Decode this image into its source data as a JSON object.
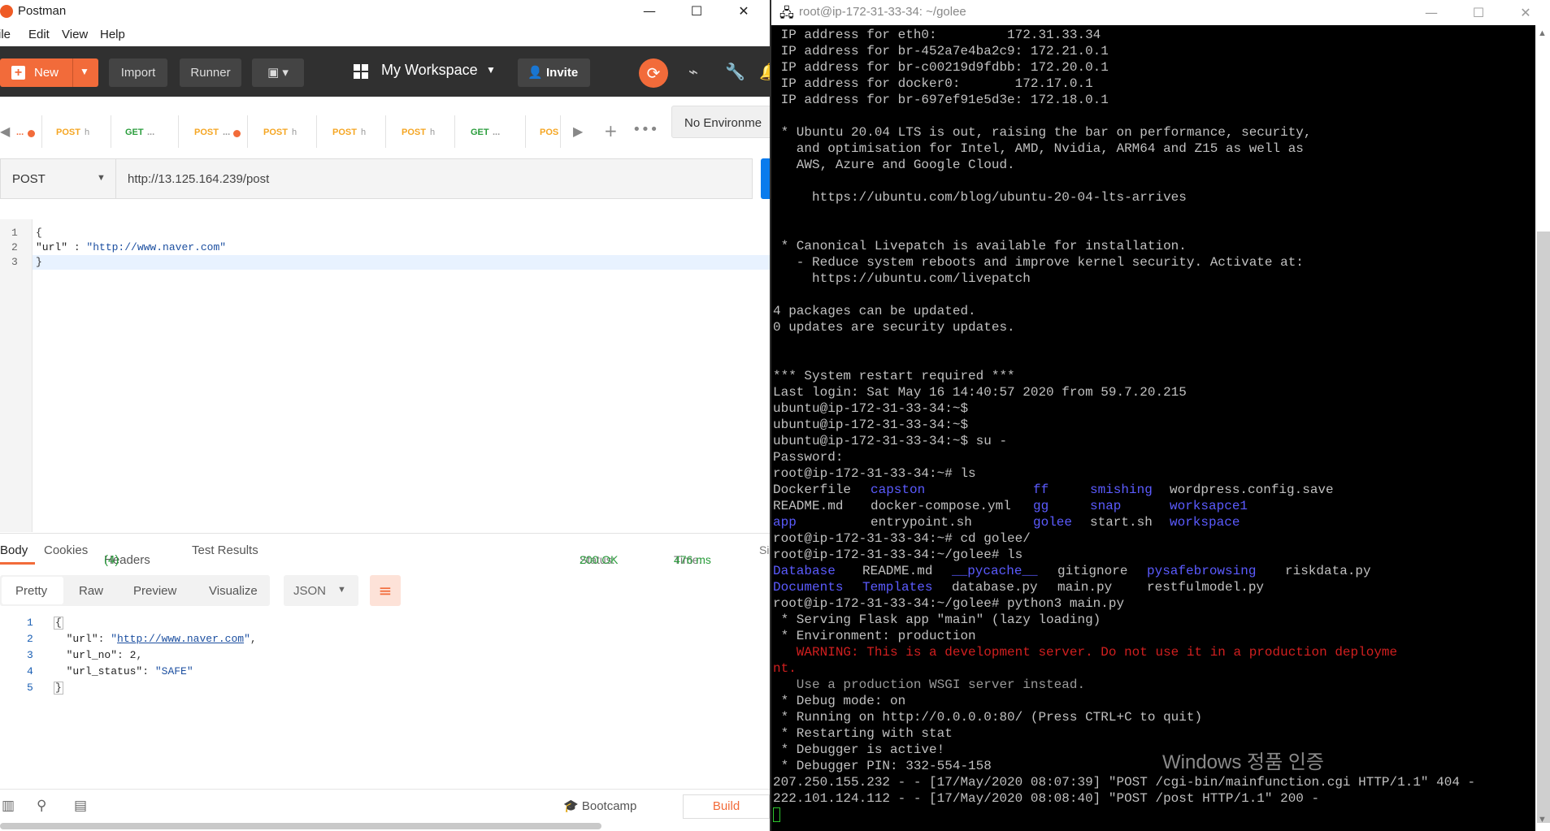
{
  "postman": {
    "title": "Postman",
    "menu": [
      "File",
      "Edit",
      "View",
      "Help"
    ],
    "menu_visible": [
      "ile",
      "Edit",
      "View",
      "Help"
    ],
    "toolbar": {
      "new_label": "New",
      "import_label": "Import",
      "runner_label": "Runner",
      "workspace_label": "My Workspace",
      "invite_label": "Invite"
    },
    "tabs": [
      {
        "method": "...",
        "dirty": true
      },
      {
        "method": "POST",
        "name": "h"
      },
      {
        "method": "GET",
        "name": "..."
      },
      {
        "method": "POST",
        "name": "...",
        "dirty": true
      },
      {
        "method": "POST",
        "name": "h"
      },
      {
        "method": "POST",
        "name": "h"
      },
      {
        "method": "POST",
        "name": "h"
      },
      {
        "method": "GET",
        "name": "..."
      },
      {
        "method": "POS",
        "name": ""
      }
    ],
    "environment": "No Environme",
    "request": {
      "method": "POST",
      "url": "http://13.125.164.239/post",
      "body_lines": [
        "1",
        "2",
        "3"
      ]
    },
    "response_tabs": {
      "body": "Body",
      "cookies": "Cookies",
      "headers": "Headers",
      "headers_count": "(4)",
      "test_results": "Test Results",
      "status_label": "Status:",
      "status_value": "200 OK",
      "time_label": "Time:",
      "time_value": "476 ms",
      "size_label": "Si"
    },
    "view_modes": [
      "Pretty",
      "Raw",
      "Preview",
      "Visualize"
    ],
    "format": "JSON",
    "response_lines": [
      "1",
      "2",
      "3",
      "4",
      "5"
    ],
    "footer": {
      "bootcamp": "Bootcamp",
      "build": "Build"
    },
    "colors": {
      "accent": "#f26b3a",
      "toolbar": "#303030",
      "status_green": "#2a9d3c"
    }
  },
  "terminal": {
    "title": "root@ip-172-31-33-34: ~/golee",
    "lines": [
      {
        "t": " IP address for eth0:         172.31.33.34"
      },
      {
        "t": " IP address for br-452a7e4ba2c9: 172.21.0.1"
      },
      {
        "t": " IP address for br-c00219d9fdbb: 172.20.0.1"
      },
      {
        "t": " IP address for docker0:       172.17.0.1"
      },
      {
        "t": " IP address for br-697ef91e5d3e: 172.18.0.1"
      },
      {
        "t": ""
      },
      {
        "t": " * Ubuntu 20.04 LTS is out, raising the bar on performance, security,"
      },
      {
        "t": "   and optimisation for Intel, AMD, Nvidia, ARM64 and Z15 as well as"
      },
      {
        "t": "   AWS, Azure and Google Cloud."
      },
      {
        "t": ""
      },
      {
        "t": "     https://ubuntu.com/blog/ubuntu-20-04-lts-arrives"
      },
      {
        "t": ""
      },
      {
        "t": ""
      },
      {
        "t": " * Canonical Livepatch is available for installation."
      },
      {
        "t": "   - Reduce system reboots and improve kernel security. Activate at:"
      },
      {
        "t": "     https://ubuntu.com/livepatch"
      },
      {
        "t": ""
      },
      {
        "t": "4 packages can be updated."
      },
      {
        "t": "0 updates are security updates."
      },
      {
        "t": ""
      },
      {
        "t": ""
      },
      {
        "t": "*** System restart required ***"
      },
      {
        "t": "Last login: Sat May 16 14:40:57 2020 from 59.7.20.215"
      },
      {
        "t": "ubuntu@ip-172-31-33-34:~$"
      },
      {
        "t": "ubuntu@ip-172-31-33-34:~$"
      },
      {
        "t": "ubuntu@ip-172-31-33-34:~$ su -"
      },
      {
        "t": "Password:"
      },
      {
        "t": "root@ip-172-31-33-34:~# ls"
      }
    ],
    "ls_home": [
      [
        "Dockerfile",
        "capston",
        "ff",
        "smishing",
        "wordpress.config.save"
      ],
      [
        "README.md",
        "docker-compose.yml",
        "gg",
        "snap",
        "worksapce1"
      ],
      [
        "app",
        "entrypoint.sh",
        "golee",
        "start.sh",
        "workspace"
      ]
    ],
    "cmd_cd": "root@ip-172-31-33-34:~# cd golee/",
    "cmd_ls2": "root@ip-172-31-33-34:~/golee# ls",
    "ls_golee": [
      [
        "Database",
        "README.md",
        "__pycache__",
        "gitignore",
        "pysafebrowsing",
        "riskdata.py"
      ],
      [
        "Documents",
        "Templates",
        "database.py",
        "main.py",
        "restfulmodel.py"
      ]
    ],
    "cmd_run": "root@ip-172-31-33-34:~/golee# python3 main.py",
    "flask_lines": [
      " * Serving Flask app \"main\" (lazy loading)",
      " * Environment: production"
    ],
    "warning_lines": [
      "   WARNING: This is a development server. Do not use it in a production deployme",
      "nt."
    ],
    "hint_line": "   Use a production WSGI server instead.",
    "tail_lines": [
      " * Debug mode: on",
      " * Running on http://0.0.0.0:80/ (Press CTRL+C to quit)",
      " * Restarting with stat",
      " * Debugger is active!",
      " * Debugger PIN: 332-554-158",
      "207.250.155.232 - - [17/May/2020 08:07:39] \"POST /cgi-bin/mainfunction.cgi HTTP/1.1\" 404 -",
      "222.101.124.112 - - [17/May/2020 08:08:40] \"POST /post HTTP/1.1\" 200 -"
    ]
  },
  "watermark": "Windows 정품 인증"
}
